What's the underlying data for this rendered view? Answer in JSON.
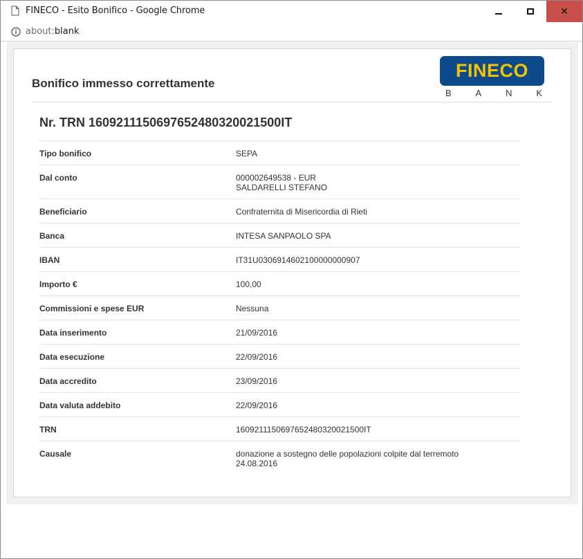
{
  "window": {
    "title": "FINECO - Esito Bonifico - Google Chrome",
    "minimize_label": "minimize",
    "maximize_label": "maximize",
    "close_label": "close"
  },
  "address": {
    "scheme": "about:",
    "rest": "blank"
  },
  "page": {
    "heading": "Bonifico immesso correttamente",
    "logo": {
      "word": "FINECO",
      "bank": [
        "B",
        "A",
        "N",
        "K"
      ],
      "box_color": "#0d4a8c",
      "word_color": "#f5c400"
    },
    "trn_heading": "Nr. TRN 1609211150697652480320021500IT",
    "details": [
      {
        "label": "Tipo bonifico",
        "values": [
          "SEPA"
        ]
      },
      {
        "label": "Dal conto",
        "values": [
          "000002649538 - EUR",
          "SALDARELLI STEFANO"
        ]
      },
      {
        "label": "Beneficiario",
        "values": [
          "Confraternita di Misericordia di Rieti"
        ]
      },
      {
        "label": "Banca",
        "values": [
          "INTESA SANPAOLO SPA"
        ]
      },
      {
        "label": "IBAN",
        "values": [
          "IT31U0306914602100000000907"
        ]
      },
      {
        "label": "Importo €",
        "values": [
          "100,00"
        ]
      },
      {
        "label": "Commissioni e spese EUR",
        "values": [
          "Nessuna"
        ]
      },
      {
        "label": "Data inserimento",
        "values": [
          "21/09/2016"
        ]
      },
      {
        "label": "Data esecuzione",
        "values": [
          "22/09/2016"
        ]
      },
      {
        "label": "Data accredito",
        "values": [
          "23/09/2016"
        ]
      },
      {
        "label": "Data valuta addebito",
        "values": [
          "22/09/2016"
        ]
      },
      {
        "label": "TRN",
        "values": [
          "1609211150697652480320021500IT"
        ]
      },
      {
        "label": "Causale",
        "values": [
          "donazione a sostegno delle popolazioni colpite dal terremoto",
          "24.08.2016"
        ]
      }
    ]
  }
}
